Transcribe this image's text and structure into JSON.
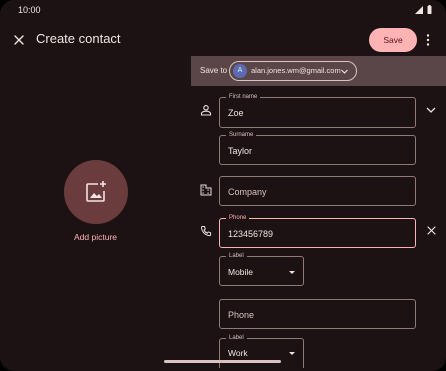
{
  "status_bar": {
    "time": "10:00"
  },
  "app_bar": {
    "title": "Create contact",
    "save_label": "Save"
  },
  "picture": {
    "label": "Add picture"
  },
  "save_to": {
    "label": "Save to",
    "account_initial": "A",
    "account_email": "alan.jones.wm@gmail.com"
  },
  "fields": {
    "first_name": {
      "label": "First name",
      "value": "Zoe"
    },
    "surname": {
      "label": "Surname",
      "value": "Taylor"
    },
    "company": {
      "placeholder": "Company"
    },
    "phone": {
      "label": "Phone",
      "value": "123456789"
    },
    "phone_label": {
      "label": "Label",
      "value": "Mobile"
    },
    "phone2": {
      "placeholder": "Phone"
    },
    "phone2_label": {
      "label": "Label",
      "value": "Work"
    }
  },
  "colors": {
    "background": "#1c1213",
    "accent": "#ffb3b4",
    "save_to_bar": "#5a4648",
    "avatar_bg": "#6b3c3e"
  }
}
